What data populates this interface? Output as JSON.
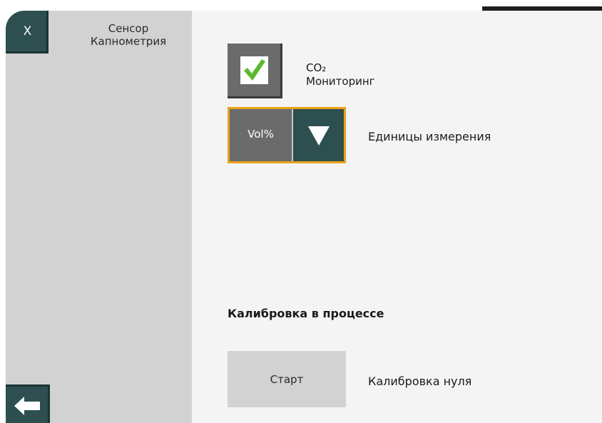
{
  "sidebar": {
    "close_label": "X",
    "title_line1": "Сенсор",
    "title_line2": "Капнометрия"
  },
  "co2": {
    "checked": true,
    "label_line1": "CO₂",
    "label_line2": "Мониторинг"
  },
  "units": {
    "selected": "Vol%",
    "label": "Единицы измерения"
  },
  "calibration": {
    "status": "Калибровка в процессе",
    "start_label": "Старт",
    "zero_label": "Калибровка нуля"
  },
  "colors": {
    "accent_dark": "#2d4f4f",
    "highlight": "#e8a118",
    "check_green": "#5cb82e"
  }
}
